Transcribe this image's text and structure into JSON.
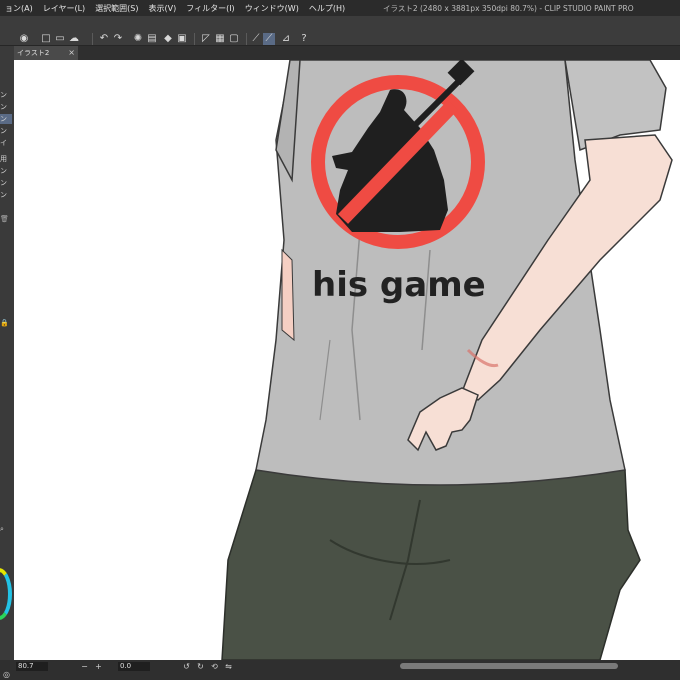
{
  "menubar": {
    "items": [
      "ョン(A)",
      "レイヤー(L)",
      "選択範囲(S)",
      "表示(V)",
      "フィルター(I)",
      "ウィンドウ(W)",
      "ヘルプ(H)"
    ],
    "window_title": "イラスト2 (2480 x 3881px 350dpi 80.7%) - CLIP STUDIO PAINT PRO"
  },
  "toolbar": {
    "icons": [
      "clip-studio-icon",
      "new-icon",
      "open-icon",
      "save-icon",
      "undo-icon",
      "redo-icon",
      "loading-icon",
      "clear-icon",
      "fill-icon",
      "transform-icon",
      "ruler-icon",
      "grid-icon",
      "snap-ruler-icon",
      "snap-special-icon",
      "snap-grid-icon",
      "help-icon"
    ]
  },
  "tabs": {
    "active_label": "イラスト2",
    "close": "×"
  },
  "left_panel": {
    "labels": [
      "ン",
      "ン",
      "ン",
      "ン",
      "イ",
      "用",
      "ン",
      "ン",
      "ン"
    ]
  },
  "shirt": {
    "caption": "his game"
  },
  "status": {
    "zoom": "80.7",
    "rotation": "0.0"
  },
  "colors": {
    "app_bg": "#3a3a3a",
    "canvas_bg": "#ffffff",
    "shirt": "#bdbdbd",
    "pants": "#4a5146",
    "skin": "#f7dfd5",
    "ban_sign": "#ef4b43",
    "accent": "#5a6b86"
  }
}
